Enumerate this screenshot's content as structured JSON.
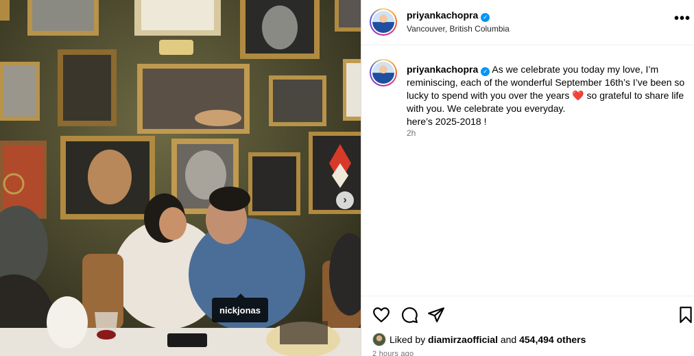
{
  "photo": {
    "tag_label": "nickjonas",
    "next_glyph": "›"
  },
  "header": {
    "username": "priyankachopra",
    "verified_glyph": "✓",
    "location": "Vancouver, British Columbia",
    "more_glyph": "•••"
  },
  "caption": {
    "username": "priyankachopra",
    "verified_glyph": "✓",
    "text_part1": "As we celebrate you today my love, I’m reminiscing, each of the wonderful September 16th’s I’ve been so lucky to spend with you over the years ",
    "heart": "❤️",
    "text_part2": " so grateful to share life with you. We celebrate you everyday.",
    "line2": "here’s 2025-2018 !",
    "time": "2h"
  },
  "actions": {
    "liked_by_prefix": "Liked by ",
    "liked_by_user": "diamirzaofficial",
    "liked_and": " and ",
    "likes_count": "454,494 others",
    "posted_ago": "2 hours ago"
  },
  "icons": [
    "heart-icon",
    "comment-icon",
    "share-icon",
    "bookmark-icon",
    "more-icon",
    "verified-icon",
    "chevron-right-icon"
  ],
  "colors": {
    "verified": "#0095f6",
    "heart": "#ed1c24",
    "muted": "#737373"
  }
}
